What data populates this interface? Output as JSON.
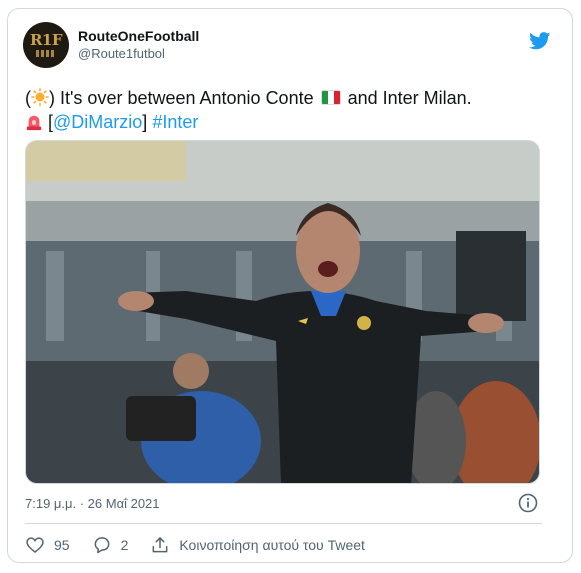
{
  "author": {
    "display_name": "RouteOneFootball",
    "handle": "@Route1futbol",
    "avatar_text": "R1F"
  },
  "tweet": {
    "line1_open": "(",
    "line1_after_emoji": ") It's over between Antonio Conte ",
    "line1_end": " and Inter Milan.",
    "line2_open": " [",
    "mention": "@DiMarzio",
    "line2_close": "] ",
    "hashtag": "#Inter"
  },
  "meta": {
    "timestamp": "7:19 μ.μ. · 26 Μαΐ 2021"
  },
  "actions": {
    "likes": "95",
    "replies": "2",
    "share_label": "Κοινοποίηση αυτού του Tweet"
  },
  "colors": {
    "link": "#1d9bf0",
    "text": "#0f1419",
    "muted": "#536471",
    "border": "#cfd9de"
  },
  "icons": [
    "twitter-bird-icon",
    "sun-emoji-icon",
    "italy-flag-icon",
    "siren-emoji-icon",
    "info-icon",
    "heart-icon",
    "reply-icon",
    "share-icon"
  ]
}
